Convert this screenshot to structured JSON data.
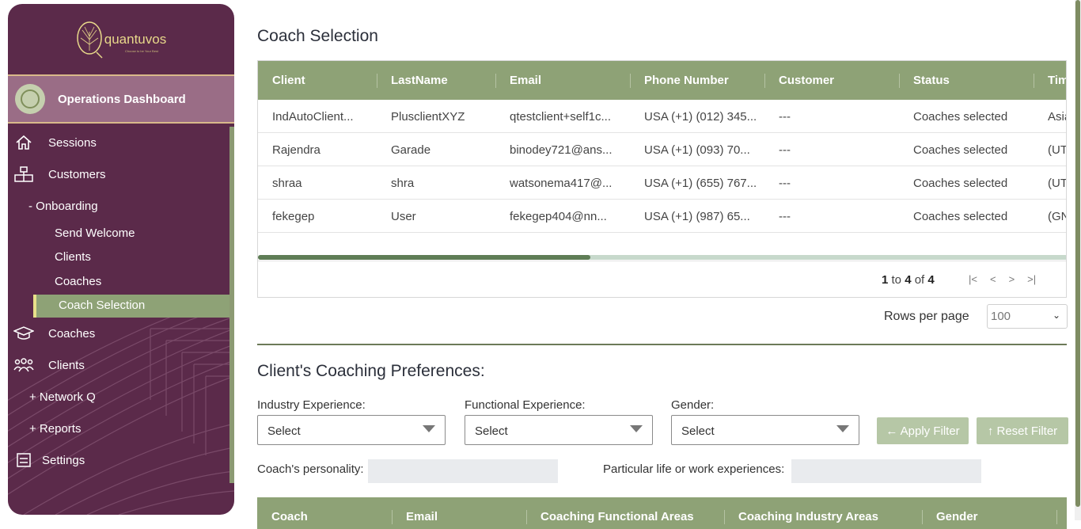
{
  "sidebar": {
    "logo_text": "quantuvos",
    "logo_tagline": "Choose to be Your Best",
    "ops_label": "Operations Dashboard",
    "items": [
      {
        "label": "Sessions",
        "icon": "home-icon"
      },
      {
        "label": "Customers",
        "icon": "org-chart-icon"
      },
      {
        "label": "- Onboarding"
      },
      {
        "label": "Send Welcome"
      },
      {
        "label": "Clients"
      },
      {
        "label": "Coaches"
      },
      {
        "label": "Coach Selection"
      },
      {
        "label": "Coaches",
        "icon": "graduation-cap-icon"
      },
      {
        "label": "Clients",
        "icon": "people-icon"
      },
      {
        "label": "+ Network Q"
      },
      {
        "label": "+ Reports"
      },
      {
        "label": "Settings",
        "icon": "settings-box-icon"
      }
    ],
    "colors": {
      "bg": "#5b2a4a",
      "active": "#8ea276"
    }
  },
  "main": {
    "title": "Coach Selection",
    "grid": {
      "columns": [
        "Client",
        "LastName",
        "Email",
        "Phone Number",
        "Customer",
        "Status",
        "Tim"
      ],
      "rows": [
        [
          "IndAutoClient...",
          "PlusclientXYZ",
          "qtestclient+self1c...",
          "USA (+1) (012) 345...",
          "---",
          "Coaches selected",
          "Asia"
        ],
        [
          "Rajendra",
          "Garade",
          "binodey721@ans...",
          "USA (+1) (093) 70...",
          "---",
          "Coaches selected",
          "(UT"
        ],
        [
          "shraa",
          "shra",
          "watsonema417@...",
          "USA (+1) (655) 767...",
          "---",
          "Coaches selected",
          "(UT"
        ],
        [
          "fekegep",
          "User",
          "fekegep404@nn...",
          "USA (+1) (987) 65...",
          "---",
          "Coaches selected",
          "(GN"
        ]
      ],
      "pager": {
        "from": "1",
        "to_word": "to",
        "to": "4",
        "of_word": "of",
        "total": "4"
      },
      "rows_per_page_label": "Rows per page",
      "rows_per_page_value": "100"
    },
    "prefs": {
      "title": "Client's Coaching Preferences:",
      "industry_label": "Industry Experience:",
      "functional_label": "Functional Experience:",
      "gender_label": "Gender:",
      "select_placeholder": "Select",
      "apply_label": "← Apply Filter",
      "reset_label": "↑ Reset Filter",
      "personality_label": "Coach's personality:",
      "experiences_label": "Particular life or work experiences:"
    },
    "grid2": {
      "columns": [
        "Coach",
        "Email",
        "Coaching Functional Areas",
        "Coaching Industry Areas",
        "Gender"
      ]
    },
    "accent": "#8ea276"
  }
}
